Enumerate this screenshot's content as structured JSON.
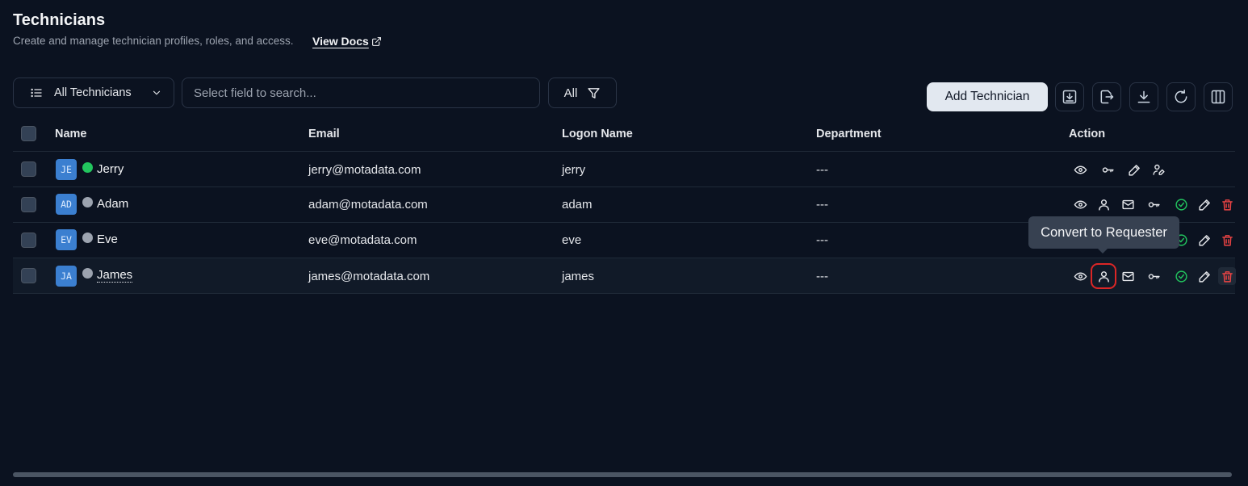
{
  "header": {
    "title": "Technicians",
    "subtitle": "Create and manage technician profiles, roles, and access.",
    "docs_link": "View Docs"
  },
  "toolbar": {
    "view_label": "All Technicians",
    "search_placeholder": "Select field to search...",
    "filter_label": "All",
    "add_button": "Add Technician"
  },
  "table": {
    "columns": [
      "Name",
      "Email",
      "Logon Name",
      "Department",
      "Action"
    ],
    "rows": [
      {
        "initials": "JE",
        "name": "Jerry",
        "status": "online",
        "email": "jerry@motadata.com",
        "logon": "jerry",
        "department": "---"
      },
      {
        "initials": "AD",
        "name": "Adam",
        "status": "offline",
        "email": "adam@motadata.com",
        "logon": "adam",
        "department": "---"
      },
      {
        "initials": "EV",
        "name": "Eve",
        "status": "offline",
        "email": "eve@motadata.com",
        "logon": "eve",
        "department": "---"
      },
      {
        "initials": "JA",
        "name": "James",
        "status": "offline",
        "email": "james@motadata.com",
        "logon": "james",
        "department": "---"
      }
    ]
  },
  "tooltip": "Convert to Requester",
  "colors": {
    "background": "#0b1220",
    "online": "#22c55e",
    "offline": "#9ca3af",
    "avatar": "#3b7fd0",
    "danger": "#ef4444",
    "focus_ring": "#dc2626"
  }
}
